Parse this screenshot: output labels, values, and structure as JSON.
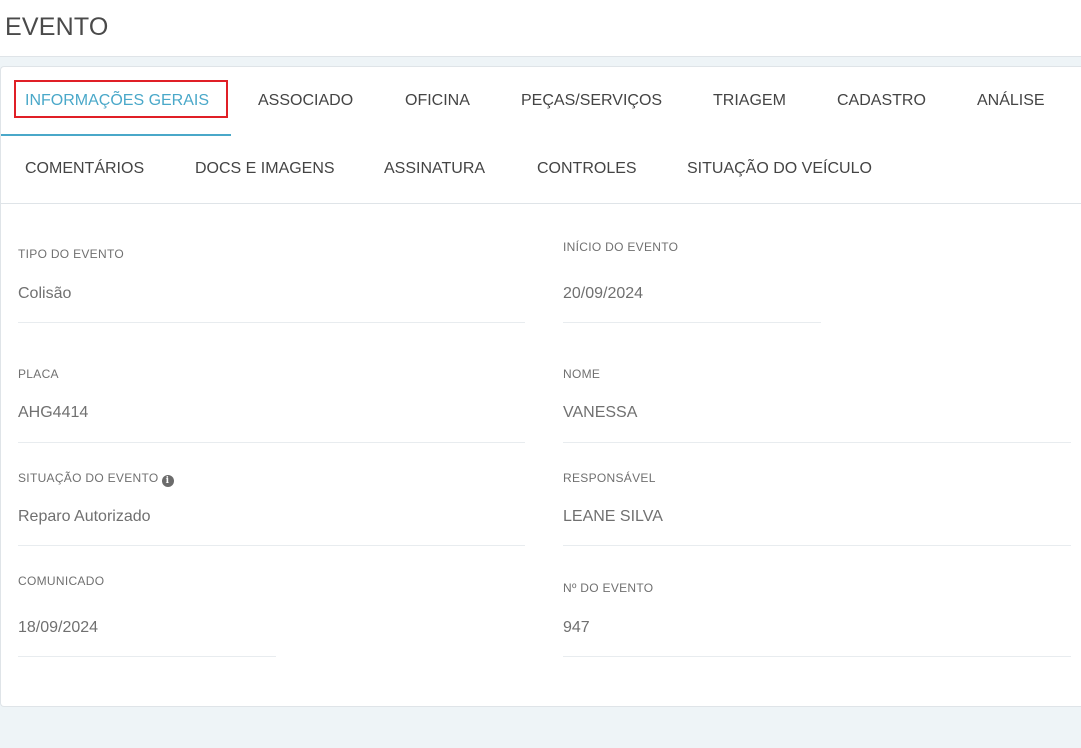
{
  "header": {
    "title": "EVENTO"
  },
  "tabs": {
    "row1": [
      {
        "label": "INFORMAÇÕES GERAIS",
        "active": true
      },
      {
        "label": "ASSOCIADO"
      },
      {
        "label": "OFICINA"
      },
      {
        "label": "PEÇAS/SERVIÇOS"
      },
      {
        "label": "TRIAGEM"
      },
      {
        "label": "CADASTRO"
      },
      {
        "label": "ANÁLISE"
      }
    ],
    "row2": [
      {
        "label": "COMENTÁRIOS"
      },
      {
        "label": "DOCS E IMAGENS"
      },
      {
        "label": "ASSINATURA"
      },
      {
        "label": "CONTROLES"
      },
      {
        "label": "SITUAÇÃO DO VEÍCULO"
      }
    ]
  },
  "fields": {
    "tipo_evento": {
      "label": "TIPO DO EVENTO",
      "value": "Colisão"
    },
    "inicio_evento": {
      "label": "INÍCIO DO EVENTO",
      "value": "20/09/2024"
    },
    "placa": {
      "label": "PLACA",
      "value": "AHG4414"
    },
    "nome": {
      "label": "NOME",
      "value": "VANESSA"
    },
    "situacao_evento": {
      "label": "SITUAÇÃO DO EVENTO",
      "value": "Reparo Autorizado",
      "icon": "info-icon"
    },
    "responsavel": {
      "label": "RESPONSÁVEL",
      "value": "LEANE SILVA"
    },
    "comunicado": {
      "label": "COMUNICADO",
      "value": "18/09/2024"
    },
    "numero_evento": {
      "label": "Nº DO EVENTO",
      "value": "947"
    }
  },
  "colors": {
    "accent": "#4aa8c9",
    "focus_outline": "#e01f26"
  }
}
